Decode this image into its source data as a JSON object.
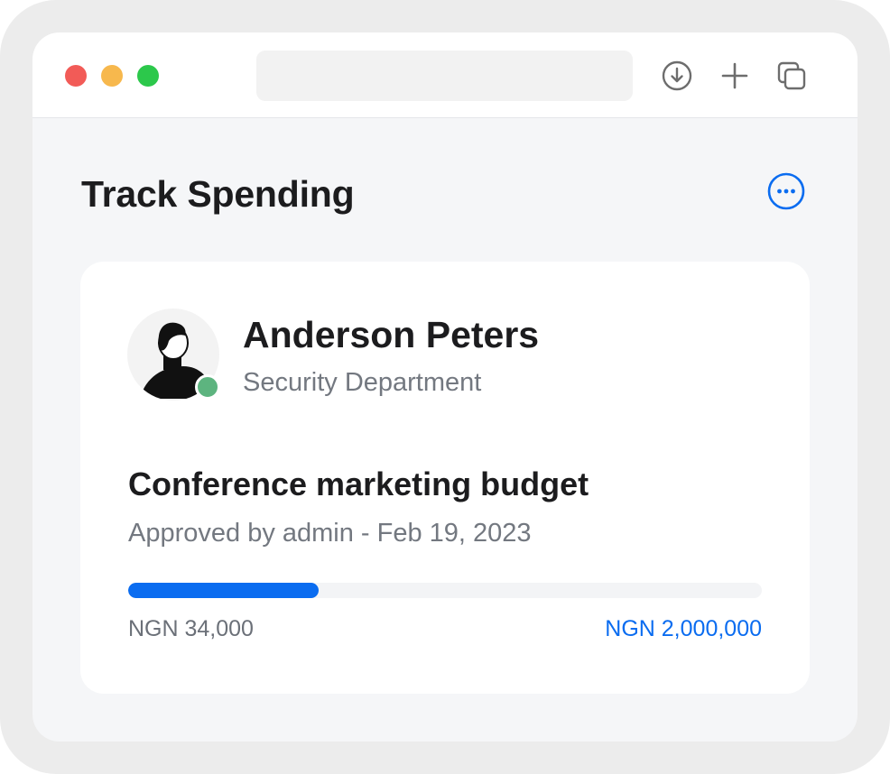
{
  "browser": {
    "traffic_lights": {
      "close": "#f25b57",
      "minimize": "#f7b84d",
      "maximize": "#2cc84b"
    },
    "url_bar_text": "",
    "toolbar_icons": [
      "download-icon",
      "plus-icon",
      "tabs-icon"
    ]
  },
  "page": {
    "title": "Track Spending",
    "more_icon": "more-horizontal-icon"
  },
  "card": {
    "user": {
      "name": "Anderson Peters",
      "department": "Security Department",
      "status_color": "#5db47f"
    },
    "budget": {
      "title": "Conference marketing budget",
      "approval": "Approved by admin - Feb 19, 2023",
      "progress_fraction": 0.3,
      "spent": "NGN 34,000",
      "total": "NGN 2,000,000"
    }
  },
  "colors": {
    "accent": "#0a6cf0",
    "text_primary": "#1c1c1e",
    "text_secondary": "#737880"
  }
}
